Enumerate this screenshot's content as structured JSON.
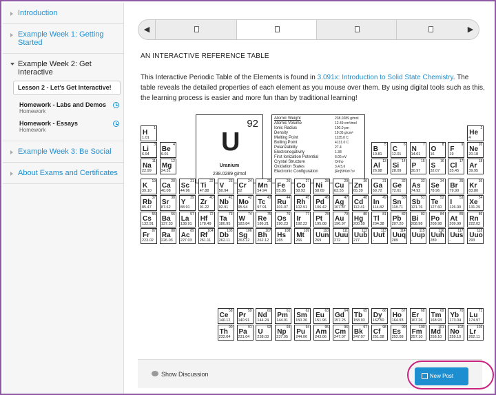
{
  "sidebar": {
    "chapters": [
      {
        "label": "Introduction"
      },
      {
        "label": "Example Week 1: Getting Started"
      },
      {
        "label": "Example Week 2: Get Interactive"
      },
      {
        "label": "Example Week 3: Be Social"
      },
      {
        "label": "About Exams and Certificates"
      }
    ],
    "active_lesson": "Lesson 2 - Let's Get Interactive!",
    "sequences": [
      {
        "title": "Homework - Labs and Demos",
        "subtitle": "Homework"
      },
      {
        "title": "Homework - Essays",
        "subtitle": "Homework"
      }
    ]
  },
  "seqnav": {
    "prev_icon": "◀",
    "next_icon": "▶",
    "tab_icons": [
      "document-icon",
      "document-icon",
      "document-icon",
      "document-icon"
    ]
  },
  "content": {
    "heading": "AN INTERACTIVE REFERENCE TABLE",
    "intro_before": "This Interactive Periodic Table of the Elements is found in ",
    "intro_link": "3.091x: Introduction to Solid State Chemistry",
    "intro_after": ". The table reveals the detailed properties of each element as you mouse over them. By using digital tools such as this, the learning process is easier and more fun than by traditional learning!"
  },
  "featured": {
    "symbol": "U",
    "number": "92",
    "name": "Uranium",
    "weight": "238.0289 g/mol"
  },
  "properties": [
    {
      "k": "Atomic Weight",
      "v": "238.0289 g/mol"
    },
    {
      "k": "Atomic Volume",
      "v": "12.49 cm³/mol"
    },
    {
      "k": "Ionic Radius",
      "v": "100.0 pm"
    },
    {
      "k": "Density",
      "v": "19.05 g/cm³"
    },
    {
      "k": "Melting Point",
      "v": "1135.0 C"
    },
    {
      "k": "Boiling Point",
      "v": "4131.0 C"
    },
    {
      "k": "Polarizability",
      "v": "27.4"
    },
    {
      "k": "Electronegativity",
      "v": "1.38"
    },
    {
      "k": "First Ionization Potential",
      "v": "6.05 eV"
    },
    {
      "k": "Crystal Structure",
      "v": "Ortho"
    },
    {
      "k": "Oxidation States",
      "v": "3,4,5,6"
    },
    {
      "k": "Electronic Configuration",
      "v": "[Rn]5f³6d¹7s²"
    }
  ],
  "elements": [
    {
      "n": 1,
      "s": "H",
      "w": "1.01",
      "r": 0,
      "c": 0
    },
    {
      "n": 2,
      "s": "He",
      "w": "4",
      "r": 0,
      "c": 17
    },
    {
      "n": 3,
      "s": "Li",
      "w": "6.94",
      "r": 1,
      "c": 0
    },
    {
      "n": 4,
      "s": "Be",
      "w": "9.01",
      "r": 1,
      "c": 1
    },
    {
      "n": 5,
      "s": "B",
      "w": "10.81",
      "r": 1,
      "c": 12
    },
    {
      "n": 6,
      "s": "C",
      "w": "12.01",
      "r": 1,
      "c": 13
    },
    {
      "n": 7,
      "s": "N",
      "w": "14.01",
      "r": 1,
      "c": 14
    },
    {
      "n": 8,
      "s": "O",
      "w": "16",
      "r": 1,
      "c": 15
    },
    {
      "n": 9,
      "s": "F",
      "w": "19",
      "r": 1,
      "c": 16
    },
    {
      "n": 10,
      "s": "Ne",
      "w": "20.18",
      "r": 1,
      "c": 17
    },
    {
      "n": 11,
      "s": "Na",
      "w": "22.99",
      "r": 2,
      "c": 0
    },
    {
      "n": 12,
      "s": "Mg",
      "w": "24.31",
      "r": 2,
      "c": 1
    },
    {
      "n": 13,
      "s": "Al",
      "w": "26.98",
      "r": 2,
      "c": 12
    },
    {
      "n": 14,
      "s": "Si",
      "w": "28.09",
      "r": 2,
      "c": 13
    },
    {
      "n": 15,
      "s": "P",
      "w": "30.97",
      "r": 2,
      "c": 14
    },
    {
      "n": 16,
      "s": "S",
      "w": "32.07",
      "r": 2,
      "c": 15
    },
    {
      "n": 17,
      "s": "Cl",
      "w": "35.45",
      "r": 2,
      "c": 16
    },
    {
      "n": 18,
      "s": "Ar",
      "w": "39.95",
      "r": 2,
      "c": 17
    },
    {
      "n": 19,
      "s": "K",
      "w": "39.10",
      "r": 3,
      "c": 0
    },
    {
      "n": 20,
      "s": "Ca",
      "w": "40.08",
      "r": 3,
      "c": 1
    },
    {
      "n": 21,
      "s": "Sc",
      "w": "44.96",
      "r": 3,
      "c": 2
    },
    {
      "n": 22,
      "s": "Ti",
      "w": "47.88",
      "r": 3,
      "c": 3
    },
    {
      "n": 23,
      "s": "V",
      "w": "50.94",
      "r": 3,
      "c": 4
    },
    {
      "n": 24,
      "s": "Cr",
      "w": "52",
      "r": 3,
      "c": 5
    },
    {
      "n": 25,
      "s": "Mn",
      "w": "54.94",
      "r": 3,
      "c": 6
    },
    {
      "n": 26,
      "s": "Fe",
      "w": "55.85",
      "r": 3,
      "c": 7
    },
    {
      "n": 27,
      "s": "Co",
      "w": "58.93",
      "r": 3,
      "c": 8
    },
    {
      "n": 28,
      "s": "Ni",
      "w": "58.69",
      "r": 3,
      "c": 9
    },
    {
      "n": 29,
      "s": "Cu",
      "w": "63.55",
      "r": 3,
      "c": 10
    },
    {
      "n": 30,
      "s": "Zn",
      "w": "65.39",
      "r": 3,
      "c": 11
    },
    {
      "n": 31,
      "s": "Ga",
      "w": "69.72",
      "r": 3,
      "c": 12
    },
    {
      "n": 32,
      "s": "Ge",
      "w": "72.61",
      "r": 3,
      "c": 13
    },
    {
      "n": 33,
      "s": "As",
      "w": "74.92",
      "r": 3,
      "c": 14
    },
    {
      "n": 34,
      "s": "Se",
      "w": "78.96",
      "r": 3,
      "c": 15
    },
    {
      "n": 35,
      "s": "Br",
      "w": "79.90",
      "r": 3,
      "c": 16
    },
    {
      "n": 36,
      "s": "Kr",
      "w": "83.80",
      "r": 3,
      "c": 17
    },
    {
      "n": 37,
      "s": "Rb",
      "w": "85.47",
      "r": 4,
      "c": 0
    },
    {
      "n": 38,
      "s": "Sr",
      "w": "87.62",
      "r": 4,
      "c": 1
    },
    {
      "n": 39,
      "s": "Y",
      "w": "88.91",
      "r": 4,
      "c": 2
    },
    {
      "n": 40,
      "s": "Zr",
      "w": "91.22",
      "r": 4,
      "c": 3
    },
    {
      "n": 41,
      "s": "Nb",
      "w": "92.91",
      "r": 4,
      "c": 4
    },
    {
      "n": 42,
      "s": "Mo",
      "w": "95.94",
      "r": 4,
      "c": 5
    },
    {
      "n": 43,
      "s": "Tc",
      "w": "97.91",
      "r": 4,
      "c": 6
    },
    {
      "n": 44,
      "s": "Ru",
      "w": "101.07",
      "r": 4,
      "c": 7
    },
    {
      "n": 45,
      "s": "Rh",
      "w": "102.91",
      "r": 4,
      "c": 8
    },
    {
      "n": 46,
      "s": "Pd",
      "w": "106.42",
      "r": 4,
      "c": 9
    },
    {
      "n": 47,
      "s": "Ag",
      "w": "107.87",
      "r": 4,
      "c": 10
    },
    {
      "n": 48,
      "s": "Cd",
      "w": "112.41",
      "r": 4,
      "c": 11
    },
    {
      "n": 49,
      "s": "In",
      "w": "114.82",
      "r": 4,
      "c": 12
    },
    {
      "n": 50,
      "s": "Sn",
      "w": "118.71",
      "r": 4,
      "c": 13
    },
    {
      "n": 51,
      "s": "Sb",
      "w": "121.76",
      "r": 4,
      "c": 14
    },
    {
      "n": 52,
      "s": "Te",
      "w": "127.60",
      "r": 4,
      "c": 15
    },
    {
      "n": 53,
      "s": "I",
      "w": "126.90",
      "r": 4,
      "c": 16
    },
    {
      "n": 54,
      "s": "Xe",
      "w": "131.29",
      "r": 4,
      "c": 17
    },
    {
      "n": 55,
      "s": "Cs",
      "w": "132.91",
      "r": 5,
      "c": 0
    },
    {
      "n": 56,
      "s": "Ba",
      "w": "137.33",
      "r": 5,
      "c": 1
    },
    {
      "n": 57,
      "s": "La",
      "w": "138.91",
      "r": 5,
      "c": 2
    },
    {
      "n": 72,
      "s": "Hf",
      "w": "178.49",
      "r": 5,
      "c": 3
    },
    {
      "n": 73,
      "s": "Ta",
      "w": "180.95",
      "r": 5,
      "c": 4
    },
    {
      "n": 74,
      "s": "W",
      "w": "183.84",
      "r": 5,
      "c": 5
    },
    {
      "n": 75,
      "s": "Re",
      "w": "186.21",
      "r": 5,
      "c": 6
    },
    {
      "n": 76,
      "s": "Os",
      "w": "190.23",
      "r": 5,
      "c": 7
    },
    {
      "n": 77,
      "s": "Ir",
      "w": "192.22",
      "r": 5,
      "c": 8
    },
    {
      "n": 78,
      "s": "Pt",
      "w": "195.08",
      "r": 5,
      "c": 9
    },
    {
      "n": 79,
      "s": "Au",
      "w": "196.97",
      "r": 5,
      "c": 10
    },
    {
      "n": 80,
      "s": "Hg",
      "w": "200.59",
      "r": 5,
      "c": 11
    },
    {
      "n": 81,
      "s": "Tl",
      "w": "204.38",
      "r": 5,
      "c": 12
    },
    {
      "n": 82,
      "s": "Pb",
      "w": "207.20",
      "r": 5,
      "c": 13
    },
    {
      "n": 83,
      "s": "Bi",
      "w": "208.98",
      "r": 5,
      "c": 14
    },
    {
      "n": 84,
      "s": "Po",
      "w": "208.98",
      "r": 5,
      "c": 15
    },
    {
      "n": 85,
      "s": "At",
      "w": "209.99",
      "r": 5,
      "c": 16
    },
    {
      "n": 86,
      "s": "Rn",
      "w": "222.02",
      "r": 5,
      "c": 17
    },
    {
      "n": 87,
      "s": "Fr",
      "w": "223.02",
      "r": 6,
      "c": 0
    },
    {
      "n": 88,
      "s": "Ra",
      "w": "226.03",
      "r": 6,
      "c": 1
    },
    {
      "n": 89,
      "s": "Ac",
      "w": "227.03",
      "r": 6,
      "c": 2
    },
    {
      "n": 104,
      "s": "Rf",
      "w": "261.11",
      "r": 6,
      "c": 3
    },
    {
      "n": 105,
      "s": "Db",
      "w": "262.11",
      "r": 6,
      "c": 4
    },
    {
      "n": 106,
      "s": "Sg",
      "w": "263.12",
      "r": 6,
      "c": 5
    },
    {
      "n": 107,
      "s": "Bh",
      "w": "262.12",
      "r": 6,
      "c": 6
    },
    {
      "n": 108,
      "s": "Hs",
      "w": "265",
      "r": 6,
      "c": 7
    },
    {
      "n": 109,
      "s": "Mt",
      "w": "266",
      "r": 6,
      "c": 8
    },
    {
      "n": 110,
      "s": "Uun",
      "w": "269",
      "r": 6,
      "c": 9
    },
    {
      "n": 111,
      "s": "Uuu",
      "w": "272",
      "r": 6,
      "c": 10
    },
    {
      "n": 112,
      "s": "Uub",
      "w": "277",
      "r": 6,
      "c": 11
    },
    {
      "n": 113,
      "s": "Uut",
      "w": "-",
      "r": 6,
      "c": 12
    },
    {
      "n": 114,
      "s": "Uuq",
      "w": "289",
      "r": 6,
      "c": 13
    },
    {
      "n": 115,
      "s": "Uup",
      "w": "-",
      "r": 6,
      "c": 14
    },
    {
      "n": 116,
      "s": "Uuh",
      "w": "289",
      "r": 6,
      "c": 15
    },
    {
      "n": 117,
      "s": "Uus",
      "w": "-",
      "r": 6,
      "c": 16
    },
    {
      "n": 118,
      "s": "Uuo",
      "w": "293",
      "r": 6,
      "c": 17
    },
    {
      "n": 58,
      "s": "Ce",
      "w": "140.12",
      "r": 8,
      "c": 4
    },
    {
      "n": 59,
      "s": "Pr",
      "w": "140.91",
      "r": 8,
      "c": 5
    },
    {
      "n": 60,
      "s": "Nd",
      "w": "144.24",
      "r": 8,
      "c": 6
    },
    {
      "n": 61,
      "s": "Pm",
      "w": "144.91",
      "r": 8,
      "c": 7
    },
    {
      "n": 62,
      "s": "Sm",
      "w": "150.36",
      "r": 8,
      "c": 8
    },
    {
      "n": 63,
      "s": "Eu",
      "w": "151.96",
      "r": 8,
      "c": 9
    },
    {
      "n": 64,
      "s": "Gd",
      "w": "157.25",
      "r": 8,
      "c": 10
    },
    {
      "n": 65,
      "s": "Tb",
      "w": "158.93",
      "r": 8,
      "c": 11
    },
    {
      "n": 66,
      "s": "Dy",
      "w": "162.50",
      "r": 8,
      "c": 12
    },
    {
      "n": 67,
      "s": "Ho",
      "w": "164.93",
      "r": 8,
      "c": 13
    },
    {
      "n": 68,
      "s": "Er",
      "w": "167.26",
      "r": 8,
      "c": 14
    },
    {
      "n": 69,
      "s": "Tm",
      "w": "168.93",
      "r": 8,
      "c": 15
    },
    {
      "n": 70,
      "s": "Yb",
      "w": "173.04",
      "r": 8,
      "c": 16
    },
    {
      "n": 71,
      "s": "Lu",
      "w": "174.97",
      "r": 8,
      "c": 17
    },
    {
      "n": 90,
      "s": "Th",
      "w": "232.04",
      "r": 9,
      "c": 4
    },
    {
      "n": 91,
      "s": "Pa",
      "w": "231.04",
      "r": 9,
      "c": 5
    },
    {
      "n": 92,
      "s": "U",
      "w": "238.03",
      "r": 9,
      "c": 6
    },
    {
      "n": 93,
      "s": "Np",
      "w": "237.05",
      "r": 9,
      "c": 7
    },
    {
      "n": 94,
      "s": "Pu",
      "w": "244.06",
      "r": 9,
      "c": 8
    },
    {
      "n": 95,
      "s": "Am",
      "w": "243.06",
      "r": 9,
      "c": 9
    },
    {
      "n": 96,
      "s": "Cm",
      "w": "247.07",
      "r": 9,
      "c": 10
    },
    {
      "n": 97,
      "s": "Bk",
      "w": "247.07",
      "r": 9,
      "c": 11
    },
    {
      "n": 98,
      "s": "Cf",
      "w": "251.08",
      "r": 9,
      "c": 12
    },
    {
      "n": 99,
      "s": "Es",
      "w": "252.08",
      "r": 9,
      "c": 13
    },
    {
      "n": 100,
      "s": "Fm",
      "w": "257.10",
      "r": 9,
      "c": 14
    },
    {
      "n": 101,
      "s": "Md",
      "w": "258.10",
      "r": 9,
      "c": 15
    },
    {
      "n": 102,
      "s": "No",
      "w": "259.10",
      "r": 9,
      "c": 16
    },
    {
      "n": 103,
      "s": "Lr",
      "w": "262.11",
      "r": 9,
      "c": 17
    }
  ],
  "discussion": {
    "show_label": "Show Discussion",
    "new_post_label": "New Post"
  },
  "colors": {
    "accent": "#1d8fd1",
    "highlight_ring": "#c8237e",
    "frame": "#8e5aa6"
  }
}
